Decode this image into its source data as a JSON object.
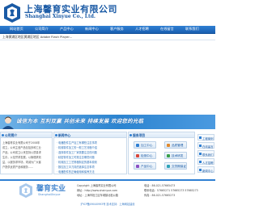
{
  "header": {
    "company_cn": "上海馨育实业有限公司",
    "company_en": "Shanghai Xinyue Co., Ltd."
  },
  "nav": {
    "items": [
      "网站首页",
      "公司简介",
      "产品中心",
      "新闻中心",
      "客户服务",
      "人才招聘",
      "在线留言",
      "联系我们"
    ]
  },
  "strip": {
    "text": "上海黄浦区地区黄浦区地区 Adobe Flash Player..."
  },
  "banner": {
    "text": "诚信为本   互利双赢   共创未来   持续发展   欢迎您的光临"
  },
  "box1": {
    "title": "公司简介",
    "lines": [
      "上海馨育实业有限公司于2008年",
      "成立，公司主营产品包括多种工业",
      "产品。公司成立以来坚持以质量求",
      "生存，以信誉求发展，以管理求效",
      "益，以服务求市场，竭诚为广大客",
      "户提供优质产品和服务……"
    ]
  },
  "box2": {
    "title": "新闻中心",
    "lines": [
      "· 电器配件生产加工有哪些注意事项",
      "· 机械零件加工的一般工艺流程介绍",
      "· 选择零件加工厂家需要注意的问题",
      "· 精密零件加工时需注意哪些问题",
      "· 机械加工工艺规程制定的基本原则",
      "· 数控加工中刀具的选择注意事项",
      "· 电器配件的正确使用和保养方法"
    ]
  },
  "box3": {
    "title": "服务项目",
    "buttons": [
      "加工中心",
      "品质管理",
      "检测中心",
      "技术研发",
      "产品中心",
      "交货期保证"
    ]
  },
  "side": {
    "links": [
      "工程案例",
      "在线留言",
      "联系我们",
      "人才招聘",
      "新闻中心"
    ]
  },
  "footer": {
    "logo_cn": "馨育实业",
    "logo_en": "ShanghaiXinyue",
    "copyright": "Copyright 上海馨育实业有限公司",
    "url": "网址：http://www.shxinyue.com",
    "address": "地址：上海市松江区车墩镇北松公路",
    "tel_label": "电话：86-021-57665473",
    "phone": "联系电话：57665271 57665273 57665273",
    "fax": "传真：86-021-57665273",
    "mobile": "手机：13816631299",
    "email": "Email：xinyue@vip.163.com",
    "bottom": "沪ICP备09040993号  技术支持：上海网站建设"
  }
}
